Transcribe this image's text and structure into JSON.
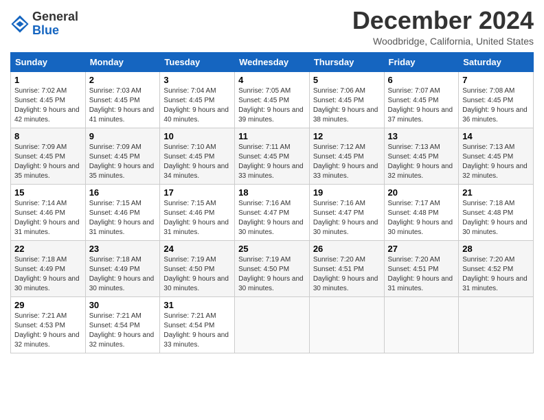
{
  "logo": {
    "general": "General",
    "blue": "Blue"
  },
  "title": "December 2024",
  "location": "Woodbridge, California, United States",
  "days_of_week": [
    "Sunday",
    "Monday",
    "Tuesday",
    "Wednesday",
    "Thursday",
    "Friday",
    "Saturday"
  ],
  "weeks": [
    [
      {
        "day": "1",
        "rise": "Sunrise: 7:02 AM",
        "set": "Sunset: 4:45 PM",
        "daylight": "Daylight: 9 hours and 42 minutes."
      },
      {
        "day": "2",
        "rise": "Sunrise: 7:03 AM",
        "set": "Sunset: 4:45 PM",
        "daylight": "Daylight: 9 hours and 41 minutes."
      },
      {
        "day": "3",
        "rise": "Sunrise: 7:04 AM",
        "set": "Sunset: 4:45 PM",
        "daylight": "Daylight: 9 hours and 40 minutes."
      },
      {
        "day": "4",
        "rise": "Sunrise: 7:05 AM",
        "set": "Sunset: 4:45 PM",
        "daylight": "Daylight: 9 hours and 39 minutes."
      },
      {
        "day": "5",
        "rise": "Sunrise: 7:06 AM",
        "set": "Sunset: 4:45 PM",
        "daylight": "Daylight: 9 hours and 38 minutes."
      },
      {
        "day": "6",
        "rise": "Sunrise: 7:07 AM",
        "set": "Sunset: 4:45 PM",
        "daylight": "Daylight: 9 hours and 37 minutes."
      },
      {
        "day": "7",
        "rise": "Sunrise: 7:08 AM",
        "set": "Sunset: 4:45 PM",
        "daylight": "Daylight: 9 hours and 36 minutes."
      }
    ],
    [
      {
        "day": "8",
        "rise": "Sunrise: 7:09 AM",
        "set": "Sunset: 4:45 PM",
        "daylight": "Daylight: 9 hours and 35 minutes."
      },
      {
        "day": "9",
        "rise": "Sunrise: 7:09 AM",
        "set": "Sunset: 4:45 PM",
        "daylight": "Daylight: 9 hours and 35 minutes."
      },
      {
        "day": "10",
        "rise": "Sunrise: 7:10 AM",
        "set": "Sunset: 4:45 PM",
        "daylight": "Daylight: 9 hours and 34 minutes."
      },
      {
        "day": "11",
        "rise": "Sunrise: 7:11 AM",
        "set": "Sunset: 4:45 PM",
        "daylight": "Daylight: 9 hours and 33 minutes."
      },
      {
        "day": "12",
        "rise": "Sunrise: 7:12 AM",
        "set": "Sunset: 4:45 PM",
        "daylight": "Daylight: 9 hours and 33 minutes."
      },
      {
        "day": "13",
        "rise": "Sunrise: 7:13 AM",
        "set": "Sunset: 4:45 PM",
        "daylight": "Daylight: 9 hours and 32 minutes."
      },
      {
        "day": "14",
        "rise": "Sunrise: 7:13 AM",
        "set": "Sunset: 4:45 PM",
        "daylight": "Daylight: 9 hours and 32 minutes."
      }
    ],
    [
      {
        "day": "15",
        "rise": "Sunrise: 7:14 AM",
        "set": "Sunset: 4:46 PM",
        "daylight": "Daylight: 9 hours and 31 minutes."
      },
      {
        "day": "16",
        "rise": "Sunrise: 7:15 AM",
        "set": "Sunset: 4:46 PM",
        "daylight": "Daylight: 9 hours and 31 minutes."
      },
      {
        "day": "17",
        "rise": "Sunrise: 7:15 AM",
        "set": "Sunset: 4:46 PM",
        "daylight": "Daylight: 9 hours and 31 minutes."
      },
      {
        "day": "18",
        "rise": "Sunrise: 7:16 AM",
        "set": "Sunset: 4:47 PM",
        "daylight": "Daylight: 9 hours and 30 minutes."
      },
      {
        "day": "19",
        "rise": "Sunrise: 7:16 AM",
        "set": "Sunset: 4:47 PM",
        "daylight": "Daylight: 9 hours and 30 minutes."
      },
      {
        "day": "20",
        "rise": "Sunrise: 7:17 AM",
        "set": "Sunset: 4:48 PM",
        "daylight": "Daylight: 9 hours and 30 minutes."
      },
      {
        "day": "21",
        "rise": "Sunrise: 7:18 AM",
        "set": "Sunset: 4:48 PM",
        "daylight": "Daylight: 9 hours and 30 minutes."
      }
    ],
    [
      {
        "day": "22",
        "rise": "Sunrise: 7:18 AM",
        "set": "Sunset: 4:49 PM",
        "daylight": "Daylight: 9 hours and 30 minutes."
      },
      {
        "day": "23",
        "rise": "Sunrise: 7:18 AM",
        "set": "Sunset: 4:49 PM",
        "daylight": "Daylight: 9 hours and 30 minutes."
      },
      {
        "day": "24",
        "rise": "Sunrise: 7:19 AM",
        "set": "Sunset: 4:50 PM",
        "daylight": "Daylight: 9 hours and 30 minutes."
      },
      {
        "day": "25",
        "rise": "Sunrise: 7:19 AM",
        "set": "Sunset: 4:50 PM",
        "daylight": "Daylight: 9 hours and 30 minutes."
      },
      {
        "day": "26",
        "rise": "Sunrise: 7:20 AM",
        "set": "Sunset: 4:51 PM",
        "daylight": "Daylight: 9 hours and 30 minutes."
      },
      {
        "day": "27",
        "rise": "Sunrise: 7:20 AM",
        "set": "Sunset: 4:51 PM",
        "daylight": "Daylight: 9 hours and 31 minutes."
      },
      {
        "day": "28",
        "rise": "Sunrise: 7:20 AM",
        "set": "Sunset: 4:52 PM",
        "daylight": "Daylight: 9 hours and 31 minutes."
      }
    ],
    [
      {
        "day": "29",
        "rise": "Sunrise: 7:21 AM",
        "set": "Sunset: 4:53 PM",
        "daylight": "Daylight: 9 hours and 32 minutes."
      },
      {
        "day": "30",
        "rise": "Sunrise: 7:21 AM",
        "set": "Sunset: 4:54 PM",
        "daylight": "Daylight: 9 hours and 32 minutes."
      },
      {
        "day": "31",
        "rise": "Sunrise: 7:21 AM",
        "set": "Sunset: 4:54 PM",
        "daylight": "Daylight: 9 hours and 33 minutes."
      },
      null,
      null,
      null,
      null
    ]
  ]
}
